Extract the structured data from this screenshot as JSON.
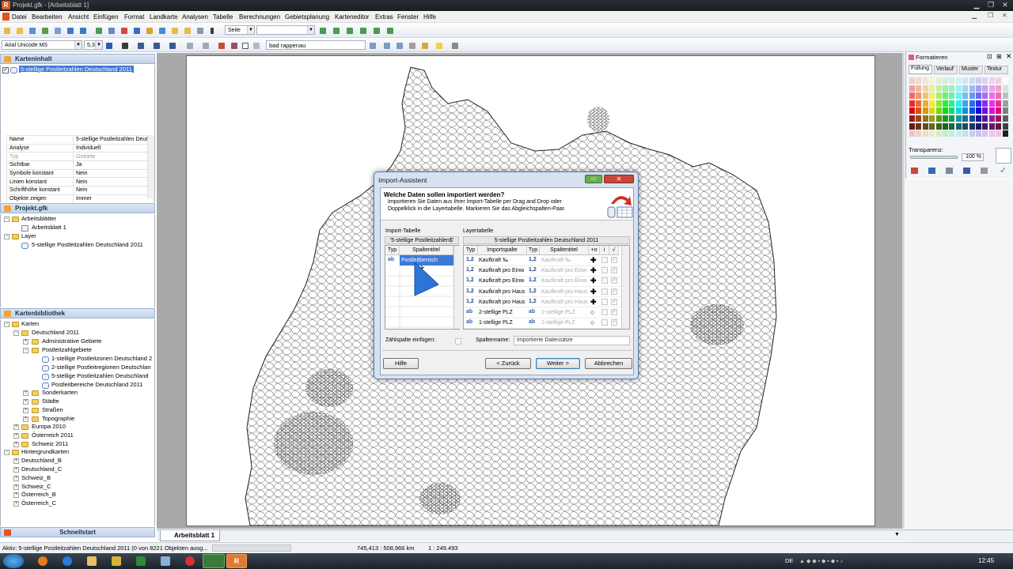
{
  "window": {
    "title": "Projekt.gfk - [Arbeitsblatt 1]",
    "app_icon": "R"
  },
  "menu": [
    "Datei",
    "Bearbeiten",
    "Ansicht",
    "Einfügen",
    "Format",
    "Landkarte",
    "Analysen",
    "Tabelle",
    "Berechnungen",
    "Gebietsplanung",
    "Karteneditor",
    "Extras",
    "Fenster",
    "Hilfe"
  ],
  "toolbar": {
    "page_label": "Seite",
    "font": "Arial Unicode MS",
    "font_size": "5,3",
    "search_value": "bad rappenau"
  },
  "kartenninhalt": {
    "header": "Karteninhalt",
    "layer": "5-stellige Postleitzahlen Deutschland 2011",
    "props": [
      {
        "k": "Name",
        "v": "5-stellige Postleitzahlen Deut"
      },
      {
        "k": "Analyse",
        "v": "Individuell"
      },
      {
        "k": "Typ",
        "v": "Gebiete"
      },
      {
        "k": "Sichtbar",
        "v": "Ja"
      },
      {
        "k": "Symbole konstant",
        "v": "Nein"
      },
      {
        "k": "Linien konstant",
        "v": "Nein"
      },
      {
        "k": "Schrifthöhe konstant",
        "v": "Nein"
      },
      {
        "k": "Objekte zeigen",
        "v": "Immer"
      }
    ]
  },
  "projekt": {
    "header": "Projekt.gfk",
    "arbeitsblaetter": "Arbeitsblätter",
    "arbeitsblatt1": "Arbeitsblatt 1",
    "layer_label": "Layer",
    "layer_item": "5-stellige Postleitzahlen Deutschland 2011"
  },
  "bibliothek": {
    "header": "Kartenbibliothek",
    "karten": "Karten",
    "de2011": "Deutschland 2011",
    "admin": "Administrative Gebiete",
    "plz": "Postleitzahlgebiete",
    "plz_items": [
      "1-stellige Postleitzonen Deutschland 2",
      "2-stellige Postleitregionen Deutschlan",
      "5-stellige Postleitzahlen Deutschland",
      "Postleitbereiche Deutschland 2011"
    ],
    "others": [
      "Sonderkarten",
      "Städte",
      "Straßen",
      "Topographie"
    ],
    "europa": "Europa 2010",
    "oesterreich": "Österreich 2011",
    "schweiz": "Schweiz 2011",
    "hintergrund": "Hintergrundkarten",
    "hg_items": [
      "Deutschland_B",
      "Deutschland_C",
      "Schweiz_B",
      "Schweiz_C",
      "Österreich_B",
      "Österreich_C"
    ]
  },
  "schnellstart": "Schnellstart",
  "formatieren": {
    "header": "Formatieren",
    "tabs": [
      "Füllung",
      "Verlauf",
      "Muster",
      "Textur"
    ],
    "transparenz_label": "Transparenz:",
    "transparenz_value": "100 %"
  },
  "dialog": {
    "title": "Import-Assistent",
    "question": "Welche Daten sollen importiert werden?",
    "desc1": "Importieren Sie Daten aus Ihrer Import-Tabelle per Drag and Drop oder",
    "desc2": "Doppelklick in die Layertabelle. Markieren Sie das Abgleichspalten-Paar.",
    "import_label": "Import-Tabelle",
    "layer_label": "Layertabelle",
    "import_table_name": "'5-stellige Postleitzahlen$'",
    "layer_table_name": "5-stellige Postleitzahlen Deutschland 2011",
    "col_typ": "Typ",
    "col_spaltentitel": "Spaltentitel",
    "col_importspalte": "Importspalte",
    "col_plus": "+o",
    "col_i": "i",
    "col_check": "√",
    "import_rows": [
      {
        "type": "ab",
        "title": "Postleitbereich"
      }
    ],
    "layer_rows": [
      {
        "type": "1,2",
        "import": "Kaufkraft ‰",
        "title": "Kaufkraft ‰",
        "op": "+"
      },
      {
        "type": "1,2",
        "import": "Kaufkraft pro Einw",
        "title": "Kaufkraft pro Einw",
        "op": "+"
      },
      {
        "type": "1,2",
        "import": "Kaufkraft pro Einw",
        "title": "Kaufkraft pro Einw",
        "op": "+"
      },
      {
        "type": "1,2",
        "import": "Kaufkraft pro Haus",
        "title": "Kaufkraft pro Haus",
        "op": "+"
      },
      {
        "type": "1,2",
        "import": "Kaufkraft pro Haus",
        "title": "Kaufkraft pro Haus",
        "op": "+"
      },
      {
        "type": "ab",
        "import": "2-stellige PLZ",
        "title": "2-stellige PLZ",
        "op": "o"
      },
      {
        "type": "ab",
        "import": "1-stellige PLZ",
        "title": "1-stellige PLZ",
        "op": "o"
      }
    ],
    "zaehlspalte_label": "Zählspalte einfügen:",
    "spaltenname_label": "Spaltenname:",
    "spaltenname_value": "Importierte Datensätze",
    "btn_help": "Hilfe",
    "btn_back": "< Zurück",
    "btn_next": "Weiter >",
    "btn_cancel": "Abbrechen"
  },
  "sheet_tab": "Arbeitsblatt 1",
  "status": {
    "left": "Aktiv: 5-stellige Postleitzahlen Deutschland 2011 (0 von 8221 Objekten ausg...",
    "coords": "745,413 : 508,966 km",
    "scale": "1 : 249.493"
  },
  "taskbar": {
    "lang": "DE",
    "time": "12:45"
  }
}
